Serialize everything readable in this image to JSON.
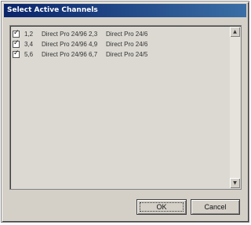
{
  "window": {
    "title": "Select Active Channels"
  },
  "channels": [
    {
      "checked": true,
      "channel": "1,2",
      "device": "Direct Pro 24/96 2,3",
      "format": "Direct Pro 24/6"
    },
    {
      "checked": true,
      "channel": "3,4",
      "device": "Direct Pro 24/96 4,9",
      "format": "Direct Pro 24/6"
    },
    {
      "checked": true,
      "channel": "5,6",
      "device": "Direct Pro 24/96 6,7",
      "format": "Direct Pro 24/5"
    }
  ],
  "buttons": {
    "ok": "OK",
    "cancel": "Cancel"
  },
  "icons": {
    "scroll_up": "scroll-up-arrow-icon",
    "scroll_down": "scroll-down-arrow-icon"
  }
}
